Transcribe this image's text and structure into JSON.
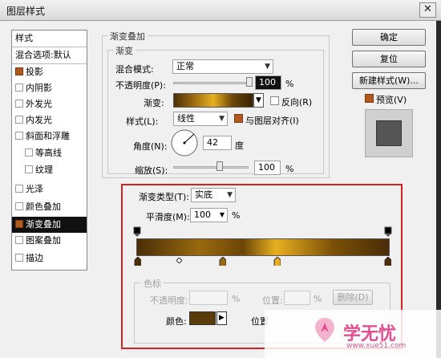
{
  "window": {
    "title": "图层样式",
    "close_glyph": "✕"
  },
  "left_list": {
    "header": "样式",
    "blend_default": "混合选项:默认",
    "items": [
      {
        "label": "投影",
        "checked": true
      },
      {
        "label": "内阴影",
        "checked": false
      },
      {
        "label": "外发光",
        "checked": false
      },
      {
        "label": "内发光",
        "checked": false
      },
      {
        "label": "斜面和浮雕",
        "checked": false
      },
      {
        "label": "等高线",
        "checked": false
      },
      {
        "label": "纹理",
        "checked": false
      },
      {
        "label": "光泽",
        "checked": false
      },
      {
        "label": "颜色叠加",
        "checked": false
      },
      {
        "label": "渐变叠加",
        "checked": true,
        "selected": true
      },
      {
        "label": "图案叠加",
        "checked": false
      },
      {
        "label": "描边",
        "checked": false
      }
    ]
  },
  "panel": {
    "title": "渐变叠加",
    "sub_title": "渐变",
    "blend_mode_label": "混合模式:",
    "blend_mode_value": "正常",
    "opacity_label": "不透明度(P):",
    "opacity_value": "100",
    "percent": "%",
    "gradient_label": "渐变:",
    "reverse_label": "反向(R)",
    "style_label": "样式(L):",
    "style_value": "线性",
    "align_label": "与图层对齐(I)",
    "angle_label": "角度(N):",
    "angle_value": "42",
    "degree": "度",
    "scale_label": "缩放(S):",
    "scale_value": "100"
  },
  "buttons": {
    "ok": "确定",
    "reset": "复位",
    "new_style": "新建样式(W)...",
    "preview_label": "预览(V)"
  },
  "editor": {
    "gradient_type_label": "渐变类型(T):",
    "gradient_type_value": "实底",
    "smoothness_label": "平滑度(M):",
    "smoothness_value": "100",
    "percent": "%",
    "color_stops_title": "色标",
    "stop_opacity_label": "不透明度:",
    "location_label": "位置:",
    "delete_label": "删除(D)",
    "color_label": "颜色:",
    "location_label2": "位置"
  },
  "watermark": {
    "text": "学无忧",
    "url": "www.xue51.com"
  },
  "colors": {
    "swatch": "#5a3c0a",
    "accent_check": "#b05a20",
    "selection": "#111111",
    "highlight_border": "#d42020"
  }
}
